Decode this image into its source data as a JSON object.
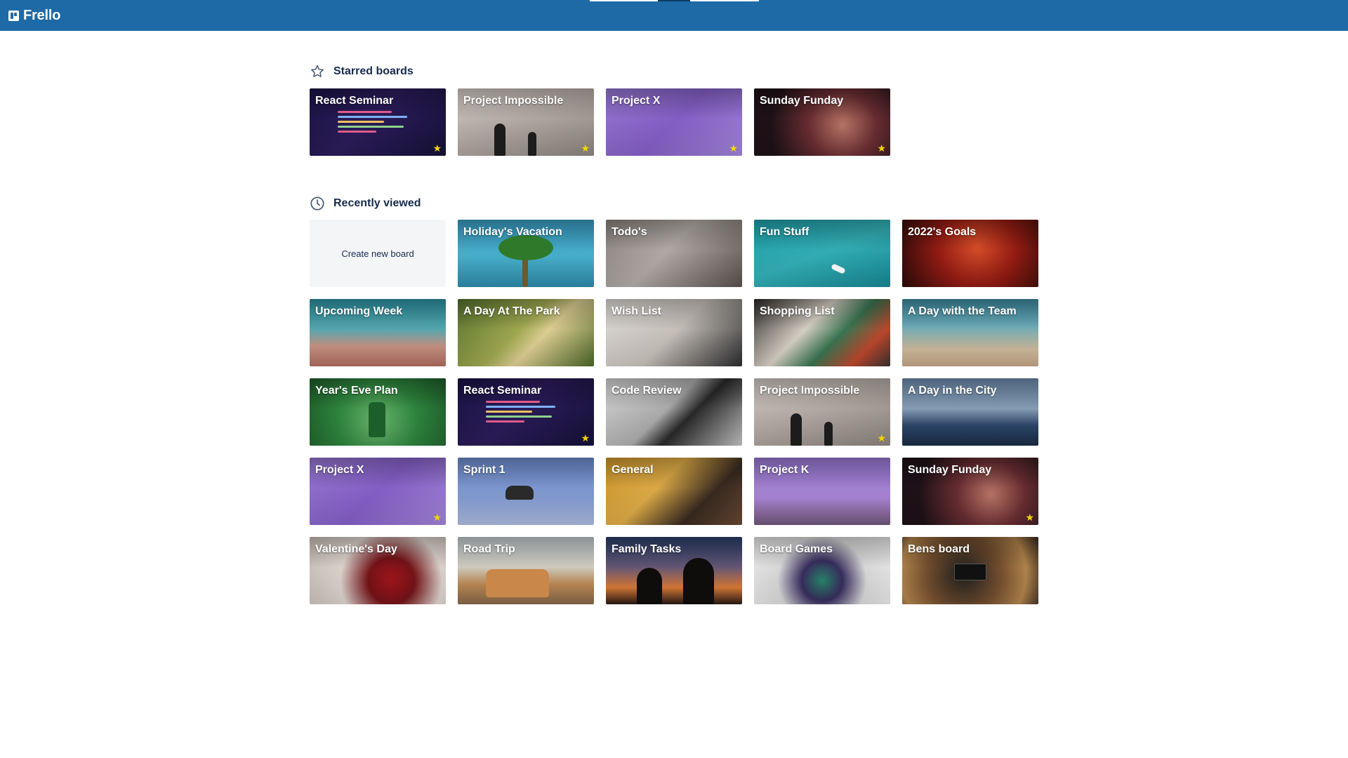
{
  "app": {
    "name": "Frello"
  },
  "starred": {
    "heading": "Starred boards",
    "boards": [
      {
        "title": "React Seminar",
        "starred": true
      },
      {
        "title": "Project Impossible",
        "starred": true
      },
      {
        "title": "Project X",
        "starred": true
      },
      {
        "title": "Sunday Funday",
        "starred": true
      }
    ]
  },
  "recent": {
    "heading": "Recently viewed",
    "create_label": "Create new board",
    "boards": [
      {
        "title": "Holiday's Vacation",
        "starred": false
      },
      {
        "title": "Todo's",
        "starred": false
      },
      {
        "title": "Fun Stuff",
        "starred": false
      },
      {
        "title": "2022's Goals",
        "starred": false
      },
      {
        "title": "Upcoming Week",
        "starred": false
      },
      {
        "title": "A Day At The Park",
        "starred": false
      },
      {
        "title": "Wish List",
        "starred": false
      },
      {
        "title": "Shopping List",
        "starred": false
      },
      {
        "title": "A Day with the Team",
        "starred": false
      },
      {
        "title": "Year's Eve Plan",
        "starred": false
      },
      {
        "title": "React Seminar",
        "starred": true
      },
      {
        "title": "Code Review",
        "starred": false
      },
      {
        "title": "Project Impossible",
        "starred": true
      },
      {
        "title": "A Day in the City",
        "starred": false
      },
      {
        "title": "Project X",
        "starred": true
      },
      {
        "title": "Sprint 1",
        "starred": false
      },
      {
        "title": "General",
        "starred": false
      },
      {
        "title": "Project K",
        "starred": false
      },
      {
        "title": "Sunday Funday",
        "starred": true
      },
      {
        "title": "Valentine's Day",
        "starred": false
      },
      {
        "title": "Road Trip",
        "starred": false
      },
      {
        "title": "Family Tasks",
        "starred": false
      },
      {
        "title": "Board Games",
        "starred": false
      },
      {
        "title": "Bens board",
        "starred": false
      }
    ]
  },
  "icons": {
    "star": "star-icon",
    "clock": "clock-icon",
    "logo": "frello-logo-icon"
  },
  "colors": {
    "header": "#1e6aa6",
    "star": "#f2d600",
    "create_tile": "#f4f5f7"
  }
}
